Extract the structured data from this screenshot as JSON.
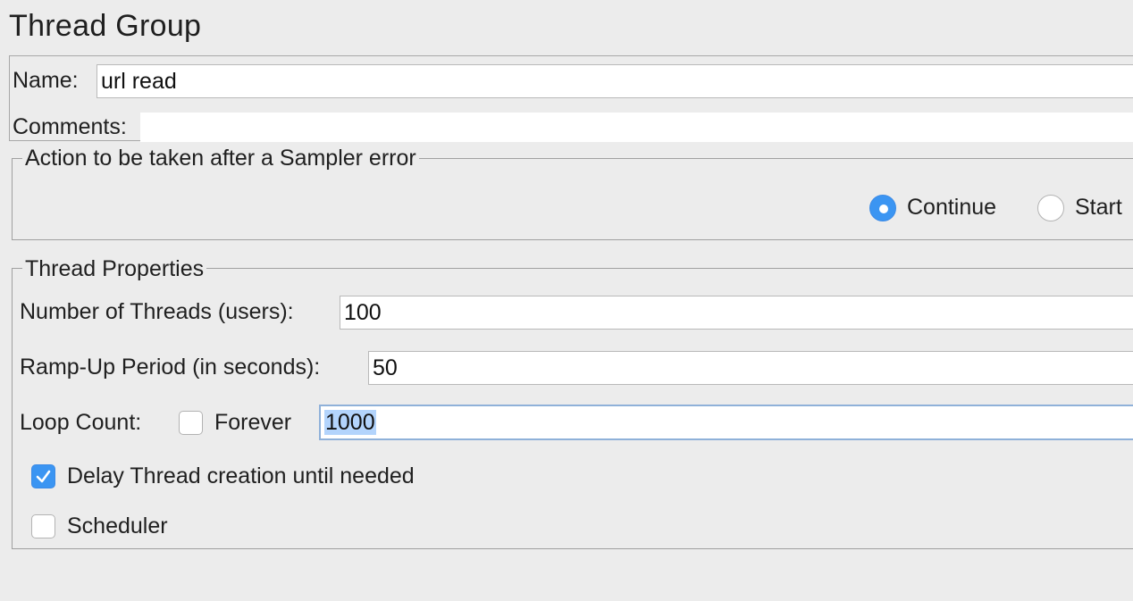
{
  "panel": {
    "title": "Thread Group"
  },
  "name_section": {
    "name_label": "Name:",
    "name_value": "url read",
    "comments_label": "Comments:",
    "comments_value": ""
  },
  "sampler_error": {
    "legend": "Action to be taken after a Sampler error",
    "options": [
      {
        "label": "Continue",
        "selected": true
      },
      {
        "label": "Start",
        "selected": false
      }
    ]
  },
  "thread_properties": {
    "legend": "Thread Properties",
    "threads_label": "Number of Threads (users):",
    "threads_value": "100",
    "rampup_label": "Ramp-Up Period (in seconds):",
    "rampup_value": "50",
    "loop_label": "Loop Count:",
    "forever_label": "Forever",
    "forever_checked": false,
    "loop_value": "1000",
    "delay_label": "Delay Thread creation until needed",
    "delay_checked": true,
    "scheduler_label": "Scheduler",
    "scheduler_checked": false
  },
  "colors": {
    "accent": "#3b95f2",
    "selection": "#b3d4fc",
    "background": "#ececec"
  }
}
